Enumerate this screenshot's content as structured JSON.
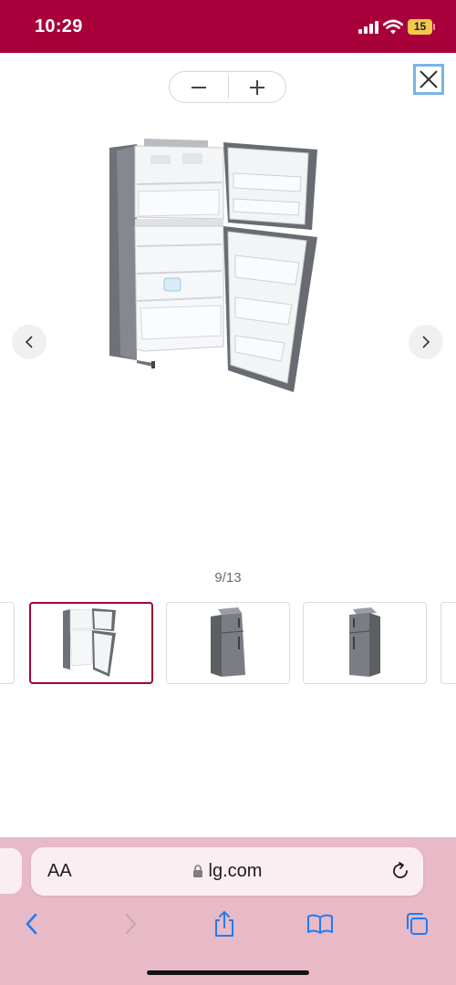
{
  "status_bar": {
    "time": "10:29",
    "battery": "15"
  },
  "viewer": {
    "zoom_out_label": "−",
    "zoom_in_label": "+",
    "counter": "9/13",
    "main_image": "fridge-open-doors",
    "thumbnails": [
      {
        "image": "partial-thumbnail",
        "active": false
      },
      {
        "image": "fridge-open-doors",
        "active": true
      },
      {
        "image": "fridge-closed-angle-left",
        "active": false
      },
      {
        "image": "fridge-closed-angle-right",
        "active": false
      },
      {
        "image": "partial-thumbnail",
        "active": false
      }
    ]
  },
  "browser": {
    "text_size_label": "AA",
    "url": "lg.com",
    "tools": [
      "back-icon",
      "forward-icon",
      "share-icon",
      "bookmarks-icon",
      "tabs-icon"
    ]
  },
  "colors": {
    "status_bar": "#a8003a",
    "active_thumb_border": "#a50034",
    "toolbar_bg": "#e8b9c6",
    "address_bg": "#fbeef2",
    "toolbar_icon": "#1f7cf6",
    "close_border": "#7ab4e6"
  }
}
